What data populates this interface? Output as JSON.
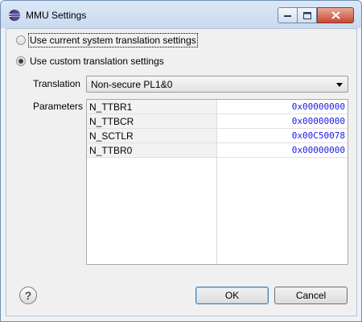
{
  "window": {
    "title": "MMU Settings",
    "icon": "eclipse-icon"
  },
  "options": {
    "current_label": "Use current system translation settings",
    "custom_label": "Use custom translation settings",
    "selected": "custom"
  },
  "translation": {
    "label": "Translation",
    "value": "Non-secure PL1&0"
  },
  "parameters": {
    "label": "Parameters",
    "rows": [
      {
        "name": "N_TTBR1",
        "value": "0x00000000"
      },
      {
        "name": "N_TTBCR",
        "value": "0x00000000"
      },
      {
        "name": "N_SCTLR",
        "value": "0x00C50078"
      },
      {
        "name": "N_TTBR0",
        "value": "0x00000000"
      }
    ]
  },
  "buttons": {
    "ok": "OK",
    "cancel": "Cancel",
    "help": "?"
  },
  "colors": {
    "value_text": "#1a1ae8",
    "accent": "#3c7fb1"
  }
}
